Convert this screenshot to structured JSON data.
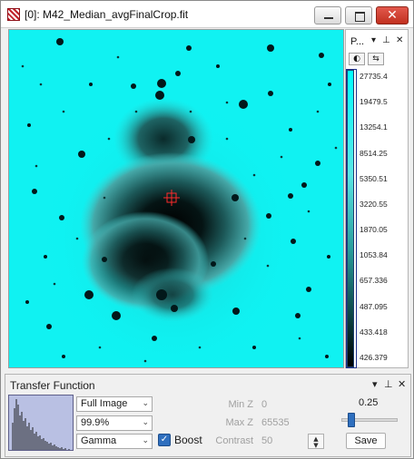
{
  "window": {
    "title": "[0]: M42_Median_avgFinalCrop.fit",
    "close_symbol": "✕"
  },
  "colorbar": {
    "title": "P...",
    "labels": [
      "27735.4",
      "19479.5",
      "13254.1",
      "8514.25",
      "5350.51",
      "3220.55",
      "1870.05",
      "1053.84",
      "657.336",
      "487.095",
      "433.418",
      "426.379"
    ],
    "colors": {
      "high": "#00ffff",
      "low": "#000000"
    }
  },
  "transfer_function": {
    "title": "Transfer Function",
    "region_select": "Full Image",
    "clip_select": "99.9%",
    "stretch_select": "Gamma",
    "boost_label": "Boost",
    "boost_checked": true,
    "min_z_label": "Min Z",
    "min_z_value": "0",
    "max_z_label": "Max Z",
    "max_z_value": "65535",
    "contrast_label": "Contrast",
    "contrast_value": "50",
    "gamma_value": "0.25",
    "gamma_level": 0.25,
    "save_label": "Save"
  },
  "icons": [
    "app-logo-icon",
    "minimize-icon",
    "maximize-icon",
    "close-icon",
    "dropdown-icon",
    "pin-icon",
    "close-panel-icon",
    "palette-icon",
    "flip-icon",
    "histogram-icon",
    "chevron-down-icon",
    "spin-up-icon",
    "spin-down-icon",
    "crosshair-icon"
  ]
}
